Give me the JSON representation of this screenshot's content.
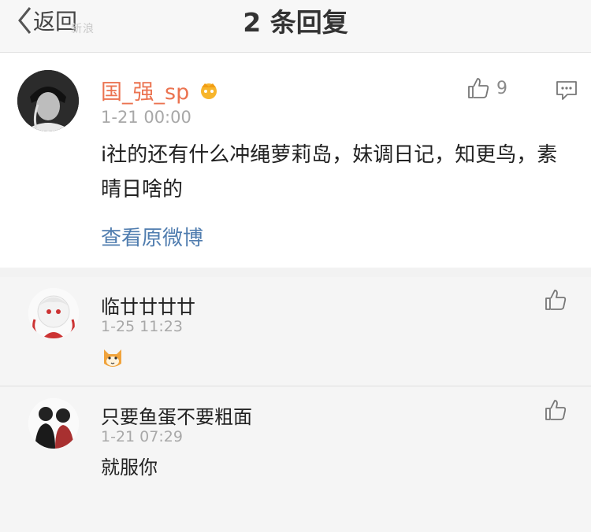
{
  "nav": {
    "back_label": "返回",
    "title": "2 条回复",
    "watermark": "新浪"
  },
  "main_comment": {
    "username": "国_强_sp",
    "timestamp": "1-21 00:00",
    "text": "i社的还有什么冲绳萝莉岛，妹调日记，知更鸟，素晴日啥的",
    "view_original": "查看原微博",
    "like_count": "9"
  },
  "replies": [
    {
      "username": "临廿廿廿廿",
      "timestamp": "1-25 11:23",
      "emoji": "cat-face-emoji"
    },
    {
      "username": "只要鱼蛋不要粗面",
      "timestamp": "1-21 07:29",
      "text": "就服你"
    }
  ],
  "colors": {
    "username": "#eb7350",
    "link": "#507daf",
    "muted": "#a8a8a8"
  },
  "icons": [
    "back-chevron-icon",
    "vip-crown-icon",
    "thumbs-up-icon",
    "comment-icon"
  ]
}
